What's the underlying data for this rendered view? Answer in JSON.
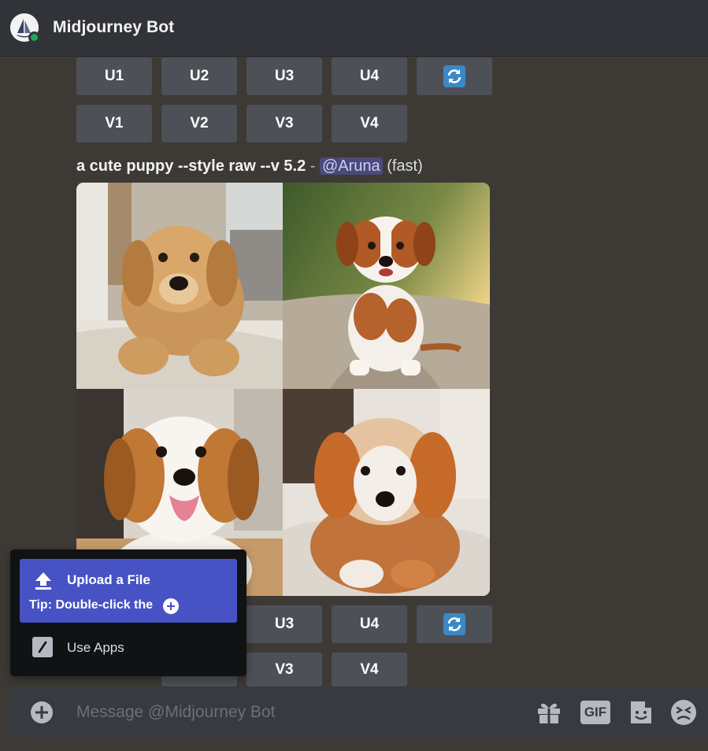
{
  "header": {
    "bot_name": "Midjourney Bot"
  },
  "top_buttons": {
    "row1": [
      "U1",
      "U2",
      "U3",
      "U4"
    ],
    "row2": [
      "V1",
      "V2",
      "V3",
      "V4"
    ]
  },
  "message": {
    "prompt": "a cute puppy --style raw --v 5.2",
    "separator": " - ",
    "mention": "@Aruna",
    "speed": "(fast)"
  },
  "grid_images": [
    {
      "icon": "puppy-golden-lying"
    },
    {
      "icon": "puppy-sitting-path"
    },
    {
      "icon": "puppy-tongue-out"
    },
    {
      "icon": "puppy-fluffy-blanket"
    }
  ],
  "bottom_buttons": {
    "row1": [
      "U3",
      "U4"
    ],
    "row2": [
      "V3",
      "V4"
    ]
  },
  "popup": {
    "upload_label": "Upload a File",
    "tip": "Tip: Double-click the",
    "apps_label": "Use Apps"
  },
  "message_bar": {
    "placeholder": "Message @Midjourney Bot",
    "gif_label": "GIF"
  },
  "colors": {
    "background": "#3d3a35",
    "header": "#313338",
    "button": "#4e5058",
    "blurple": "#4752c4",
    "refresh": "#3b88c3",
    "status_online": "#23a55a"
  }
}
